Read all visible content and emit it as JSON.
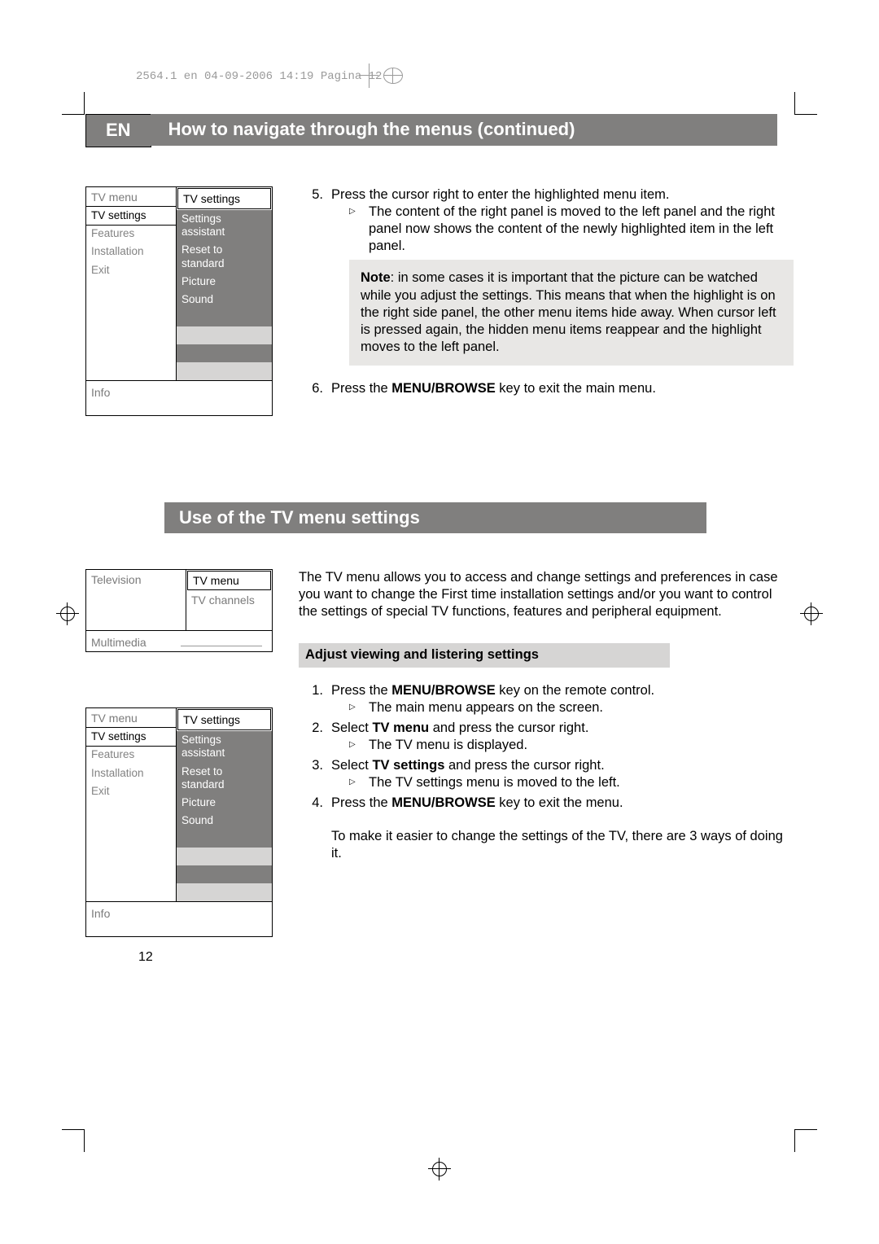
{
  "header_meta": "2564.1 en  04-09-2006  14:19  Pagina 12",
  "en_label": "EN",
  "title1": "How to navigate through the menus  (continued)",
  "title2": "Use of the TV menu settings",
  "menu1": {
    "left_header": "TV menu",
    "right_header": "TV settings",
    "left_items": [
      "TV settings",
      "Features",
      "Installation",
      "Exit"
    ],
    "right_items": [
      "Settings assistant",
      "Reset to standard",
      "Picture",
      "Sound"
    ],
    "info": "Info"
  },
  "step5_num": "5.",
  "step5_text": "Press the cursor right to enter the highlighted menu item.",
  "step5_sub": "The content of the right panel is moved to the left panel and the right panel now shows the content of the newly highlighted item in the left panel.",
  "note_label": "Note",
  "note_text": ": in some cases it is important that the picture can be watched while you adjust the settings. This means that when the highlight is on the right side panel, the other menu items hide away. When cursor left is pressed again, the hidden menu items reappear and the highlight moves to the left panel.",
  "step6_num": "6.",
  "step6_a": "Press the ",
  "step6_b": "MENU/BROWSE",
  "step6_c": " key to exit the main menu.",
  "menu2": {
    "left_top": "Television",
    "left_bottom": "Multimedia",
    "right_sel": "TV menu",
    "right_sub": "TV channels"
  },
  "para2": "The TV menu allows you to access and change settings and preferences in case you want to change the First time installation settings and/or you want to control the settings of special TV functions, features and peripheral equipment.",
  "subhead": "Adjust viewing and listering settings",
  "s1_num": "1.",
  "s1_a": "Press the ",
  "s1_b": "MENU/BROWSE",
  "s1_c": " key on the remote control.",
  "s1_sub": "The main menu appears on the screen.",
  "s2_num": "2.",
  "s2_a": "Select ",
  "s2_b": "TV menu",
  "s2_c": " and press the cursor right.",
  "s2_sub": "The TV menu is displayed.",
  "s3_num": "3.",
  "s3_a": "Select ",
  "s3_b": "TV settings",
  "s3_c": " and press the cursor right.",
  "s3_sub": "The TV settings menu is moved to the left.",
  "s4_num": "4.",
  "s4_a": "Press the ",
  "s4_b": "MENU/BROWSE",
  "s4_c": " key to exit the menu.",
  "tail": "To make it easier to change the settings of the TV, there are 3 ways of doing it.",
  "menu3": {
    "left_header": "TV menu",
    "right_header": "TV settings",
    "left_items": [
      "TV settings",
      "Features",
      "Installation",
      "Exit"
    ],
    "right_items": [
      "Settings assistant",
      "Reset to standard",
      "Picture",
      "Sound"
    ],
    "info": "Info"
  },
  "page_number": "12"
}
